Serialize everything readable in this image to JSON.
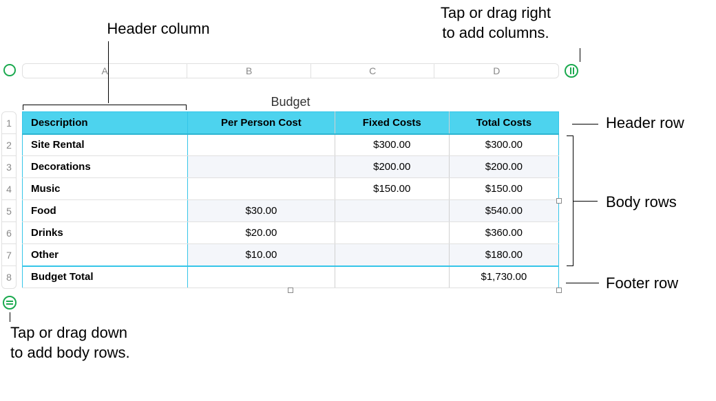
{
  "callouts": {
    "header_column": "Header column",
    "add_columns": "Tap or drag right\nto add columns.",
    "header_row": "Header row",
    "body_rows": "Body rows",
    "footer_row": "Footer row",
    "add_rows": "Tap or drag down\nto add body rows."
  },
  "table": {
    "title": "Budget",
    "columns": [
      "A",
      "B",
      "C",
      "D"
    ],
    "row_numbers": [
      "1",
      "2",
      "3",
      "4",
      "5",
      "6",
      "7",
      "8"
    ],
    "headers": {
      "description": "Description",
      "per_person": "Per Person Cost",
      "fixed": "Fixed Costs",
      "total": "Total Costs"
    },
    "rows": [
      {
        "desc": "Site Rental",
        "per": "",
        "fixed": "$300.00",
        "total": "$300.00"
      },
      {
        "desc": "Decorations",
        "per": "",
        "fixed": "$200.00",
        "total": "$200.00"
      },
      {
        "desc": "Music",
        "per": "",
        "fixed": "$150.00",
        "total": "$150.00"
      },
      {
        "desc": "Food",
        "per": "$30.00",
        "fixed": "",
        "total": "$540.00"
      },
      {
        "desc": "Drinks",
        "per": "$20.00",
        "fixed": "",
        "total": "$360.00"
      },
      {
        "desc": "Other",
        "per": "$10.00",
        "fixed": "",
        "total": "$180.00"
      }
    ],
    "footer": {
      "desc": "Budget Total",
      "per": "",
      "fixed": "",
      "total": "$1,730.00"
    }
  },
  "chart_data": {
    "type": "table",
    "title": "Budget",
    "columns": [
      "Description",
      "Per Person Cost",
      "Fixed Costs",
      "Total Costs"
    ],
    "rows": [
      [
        "Site Rental",
        null,
        300.0,
        300.0
      ],
      [
        "Decorations",
        null,
        200.0,
        200.0
      ],
      [
        "Music",
        null,
        150.0,
        150.0
      ],
      [
        "Food",
        30.0,
        null,
        540.0
      ],
      [
        "Drinks",
        20.0,
        null,
        360.0
      ],
      [
        "Other",
        10.0,
        null,
        180.0
      ]
    ],
    "footer": [
      "Budget Total",
      null,
      null,
      1730.0
    ]
  }
}
